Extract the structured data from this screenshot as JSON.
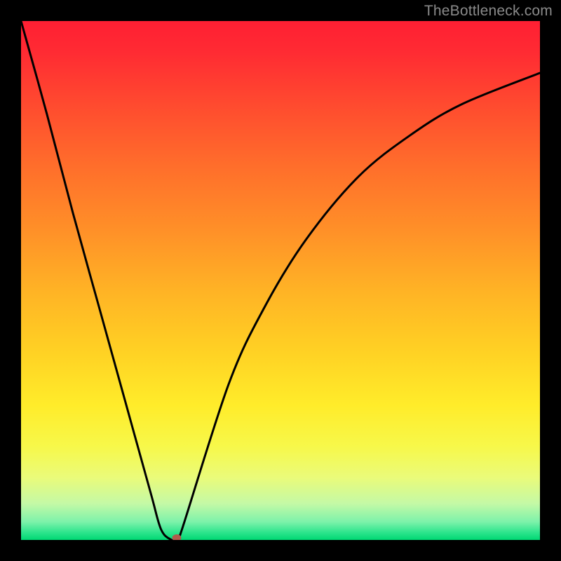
{
  "watermark": "TheBottleneck.com",
  "chart_data": {
    "type": "line",
    "title": "",
    "xlabel": "",
    "ylabel": "",
    "xlim": [
      0,
      100
    ],
    "ylim": [
      0,
      100
    ],
    "series": [
      {
        "name": "curve",
        "x": [
          0,
          5,
          10,
          15,
          20,
          25,
          27,
          29,
          30,
          31,
          40,
          47,
          55,
          65,
          75,
          85,
          100
        ],
        "y": [
          100,
          82,
          63,
          45,
          27,
          9,
          2,
          0,
          0,
          2,
          30,
          45,
          58,
          70,
          78,
          84,
          90
        ]
      }
    ],
    "marker": {
      "x": 30,
      "y": 0,
      "color": "#b15a4c"
    },
    "gradient_stops": [
      {
        "offset": 0.0,
        "color": "#ff1f33"
      },
      {
        "offset": 0.06,
        "color": "#ff2b33"
      },
      {
        "offset": 0.16,
        "color": "#ff4a2f"
      },
      {
        "offset": 0.28,
        "color": "#ff6e2b"
      },
      {
        "offset": 0.4,
        "color": "#ff8f28"
      },
      {
        "offset": 0.52,
        "color": "#ffb325"
      },
      {
        "offset": 0.64,
        "color": "#ffd224"
      },
      {
        "offset": 0.74,
        "color": "#ffec2a"
      },
      {
        "offset": 0.82,
        "color": "#f7f84a"
      },
      {
        "offset": 0.88,
        "color": "#eafb7a"
      },
      {
        "offset": 0.93,
        "color": "#c4f9a6"
      },
      {
        "offset": 0.965,
        "color": "#7df2aa"
      },
      {
        "offset": 0.985,
        "color": "#2fe58d"
      },
      {
        "offset": 1.0,
        "color": "#00d873"
      }
    ]
  }
}
